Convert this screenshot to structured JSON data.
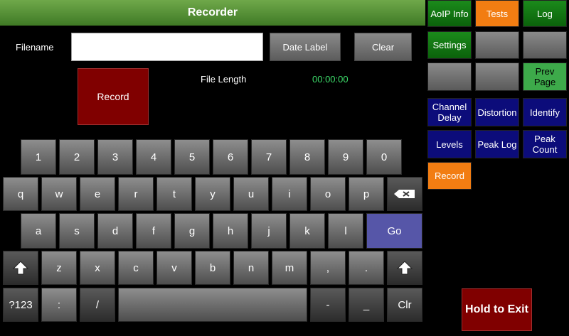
{
  "title": "Recorder",
  "filename": {
    "label": "Filename",
    "value": ""
  },
  "buttons": {
    "date_label": "Date Label",
    "clear": "Clear",
    "record": "Record",
    "hold_to_exit": "Hold to Exit"
  },
  "file_length": {
    "label": "File Length",
    "value": "00:00:00"
  },
  "keyboard": {
    "row1": [
      "1",
      "2",
      "3",
      "4",
      "5",
      "6",
      "7",
      "8",
      "9",
      "0"
    ],
    "row2": [
      "q",
      "w",
      "e",
      "r",
      "t",
      "y",
      "u",
      "i",
      "o",
      "p"
    ],
    "row3": [
      "a",
      "s",
      "d",
      "f",
      "g",
      "h",
      "j",
      "k",
      "l"
    ],
    "go": "Go",
    "row4": [
      "z",
      "x",
      "c",
      "v",
      "b",
      "n",
      "m",
      ",",
      "."
    ],
    "mode": "?123",
    "colon": ":",
    "slash": "/",
    "dash": "-",
    "underscore": "_",
    "clr": "Clr"
  },
  "side": {
    "aoip_info": "AoIP Info",
    "tests": "Tests",
    "log": "Log",
    "settings": "Settings",
    "prev_page": "Prev Page",
    "channel_delay": "Channel Delay",
    "distortion": "Distortion",
    "identify": "Identify",
    "levels": "Levels",
    "peak_log": "Peak Log",
    "peak_count": "Peak Count",
    "record": "Record"
  },
  "colors": {
    "title_green": "#4f8a30",
    "record_red": "#800000",
    "orange": "#f27d12",
    "navy": "#0c0c7a",
    "timer_green": "#3ddc6a",
    "go_blue": "#5656a8"
  }
}
